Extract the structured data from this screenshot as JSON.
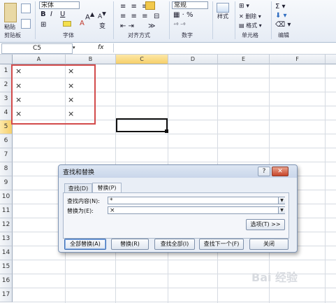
{
  "ribbon": {
    "paste_label": "粘贴",
    "groups": [
      "剪贴板",
      "字体",
      "对齐方式",
      "数字",
      "单元格",
      "编辑"
    ],
    "font_name": "宋体",
    "number_format": "常规",
    "styles_label": "样式",
    "delete_label": "删除",
    "format_label": "格式"
  },
  "formula_bar": {
    "name_box": "C5",
    "fx": "fx",
    "formula": ""
  },
  "sheet": {
    "columns": [
      "A",
      "B",
      "C",
      "D",
      "E",
      "F"
    ],
    "rows": [
      "1",
      "2",
      "3",
      "4",
      "5",
      "6",
      "7",
      "8",
      "9",
      "10",
      "11",
      "12",
      "13",
      "14",
      "15",
      "16",
      "17"
    ],
    "selected_column": "C",
    "selected_row": "5",
    "cells": [
      {
        "ref": "A1",
        "value": "×"
      },
      {
        "ref": "B1",
        "value": "×"
      },
      {
        "ref": "A2",
        "value": "×"
      },
      {
        "ref": "B2",
        "value": "×"
      },
      {
        "ref": "A3",
        "value": "×"
      },
      {
        "ref": "B3",
        "value": "×"
      },
      {
        "ref": "A4",
        "value": "×"
      },
      {
        "ref": "B4",
        "value": "×"
      }
    ]
  },
  "dialog": {
    "title": "查找和替换",
    "help_button": "?",
    "close_button": "✕",
    "tabs": [
      "查找(D)",
      "替换(P)"
    ],
    "active_tab": "替换(P)",
    "find_label": "查找内容(N):",
    "find_value": "*",
    "replace_label": "替换为(E):",
    "replace_value": "×",
    "options_button": "选项(T) >>",
    "buttons": [
      "全部替换(A)",
      "替换(R)",
      "查找全部(I)",
      "查找下一个(F)",
      "关闭"
    ]
  },
  "watermark": "Bai 经验"
}
